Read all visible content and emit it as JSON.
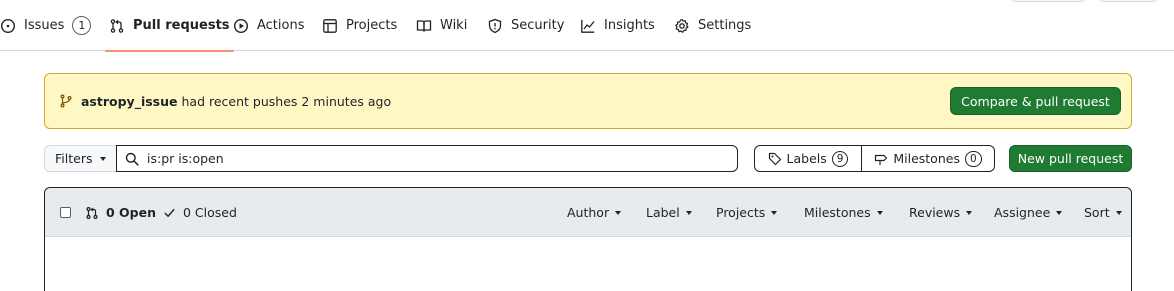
{
  "nav": {
    "tabs": [
      {
        "label": "Issues",
        "icon": "issue-opened-icon",
        "count": "1"
      },
      {
        "label": "Pull requests",
        "icon": "git-pull-request-icon",
        "selected": true
      },
      {
        "label": "Actions",
        "icon": "play-icon"
      },
      {
        "label": "Projects",
        "icon": "table-icon"
      },
      {
        "label": "Wiki",
        "icon": "book-icon"
      },
      {
        "label": "Security",
        "icon": "shield-icon"
      },
      {
        "label": "Insights",
        "icon": "graph-icon"
      },
      {
        "label": "Settings",
        "icon": "gear-icon"
      }
    ]
  },
  "banner": {
    "branch": "astropy_issue",
    "message": "had recent pushes 2 minutes ago",
    "button": "Compare & pull request"
  },
  "filters": {
    "button": "Filters",
    "search_value": "is:pr is:open",
    "labels": "Labels",
    "labels_count": "9",
    "milestones": "Milestones",
    "milestones_count": "0",
    "new_pr": "New pull request"
  },
  "list": {
    "open": "0 Open",
    "closed": "0 Closed",
    "selects": [
      "Author",
      "Label",
      "Projects",
      "Milestones",
      "Reviews",
      "Assignee",
      "Sort"
    ]
  },
  "colors": {
    "accent_underline": "#fd8c73",
    "primary_green": "#1f7a32",
    "banner_bg": "#fff8c5",
    "banner_border": "#d4a72c"
  }
}
